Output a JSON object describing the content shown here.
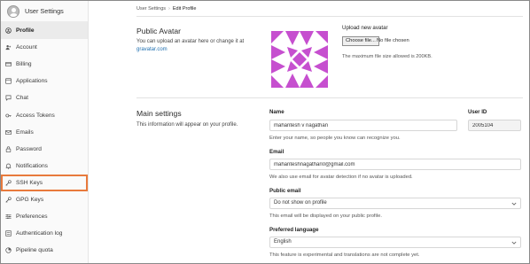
{
  "sidebar": {
    "title": "User Settings",
    "items": [
      {
        "label": "Profile",
        "icon": "profile-icon"
      },
      {
        "label": "Account",
        "icon": "account-icon"
      },
      {
        "label": "Billing",
        "icon": "billing-icon"
      },
      {
        "label": "Applications",
        "icon": "applications-icon"
      },
      {
        "label": "Chat",
        "icon": "chat-icon"
      },
      {
        "label": "Access Tokens",
        "icon": "token-icon"
      },
      {
        "label": "Emails",
        "icon": "email-icon"
      },
      {
        "label": "Password",
        "icon": "lock-icon"
      },
      {
        "label": "Notifications",
        "icon": "bell-icon"
      },
      {
        "label": "SSH Keys",
        "icon": "key-icon"
      },
      {
        "label": "GPG Keys",
        "icon": "key-icon"
      },
      {
        "label": "Preferences",
        "icon": "sliders-icon"
      },
      {
        "label": "Authentication log",
        "icon": "log-icon"
      },
      {
        "label": "Pipeline quota",
        "icon": "pipeline-icon"
      }
    ],
    "active_item": "Profile",
    "highlighted_item": "SSH Keys",
    "highlight_color": "#e87a3c"
  },
  "breadcrumb": {
    "parent": "User Settings",
    "separator": "›",
    "current": "Edit Profile"
  },
  "avatar_section": {
    "title": "Public Avatar",
    "desc": "You can upload an avatar here or change it at",
    "link": "gravatar.com",
    "upload_title": "Upload new avatar",
    "choose_file": "Choose file...",
    "no_file": "No file chosen",
    "hint": "The maximum file size allowed is 200KB.",
    "avatar_color": "#c64fcf"
  },
  "main_settings": {
    "title": "Main settings",
    "desc": "This information will appear on your profile.",
    "name": {
      "label": "Name",
      "value": "mahantesh v nagathan",
      "help": "Enter your name, so people you know can recognize you."
    },
    "user_id": {
      "label": "User ID",
      "value": "2005104"
    },
    "email": {
      "label": "Email",
      "value": "mahanteshnagathan0@gmail.com",
      "help": "We also use email for avatar detection if no avatar is uploaded."
    },
    "public_email": {
      "label": "Public email",
      "value": "Do not show on profile",
      "help": "This email will be displayed on your public profile."
    },
    "preferred_language": {
      "label": "Preferred language",
      "value": "English",
      "help": "This feature is experimental and translations are not complete yet."
    }
  }
}
